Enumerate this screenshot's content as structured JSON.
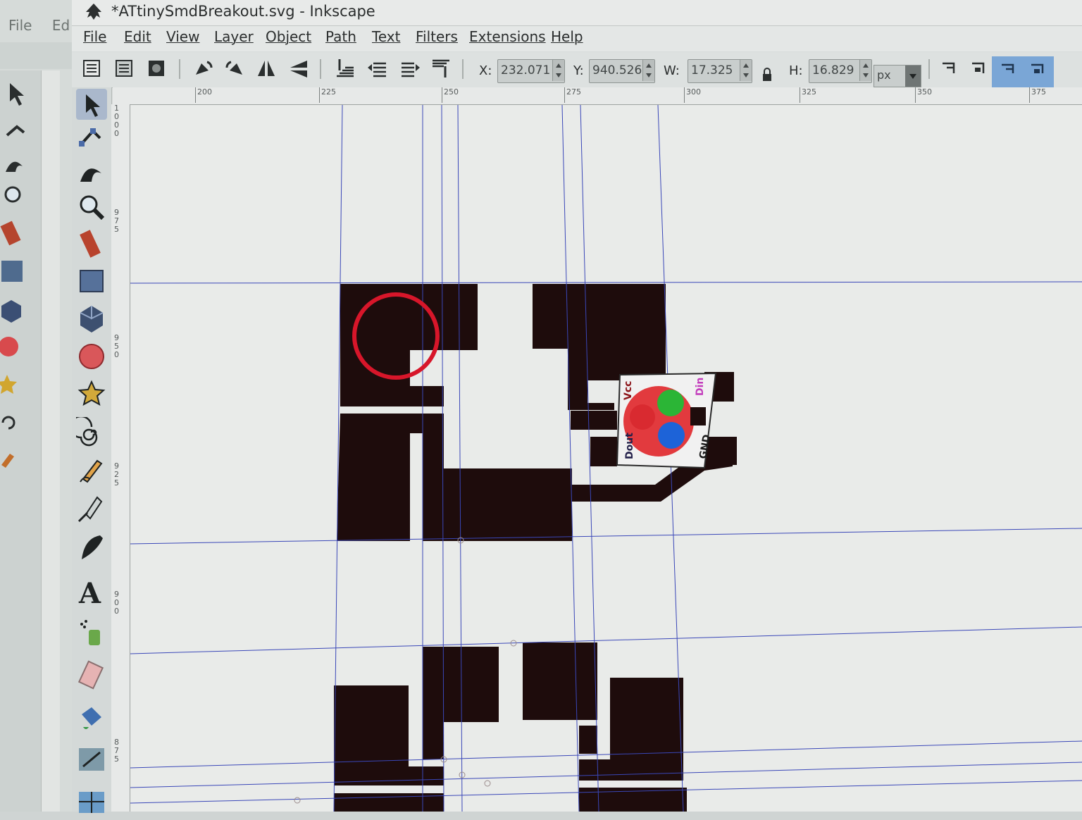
{
  "window": {
    "title": "*ATtinySmdBreakout.svg - Inkscape"
  },
  "background_window": {
    "menu": [
      "File",
      "Ed"
    ]
  },
  "menubar": {
    "items": [
      "File",
      "Edit",
      "View",
      "Layer",
      "Object",
      "Path",
      "Text",
      "Filters",
      "Extensions",
      "Help"
    ]
  },
  "toolbar": {
    "x_label": "X:",
    "x_value": "232.071",
    "y_label": "Y:",
    "y_value": "940.526",
    "w_label": "W:",
    "w_value": "17.325",
    "h_label": "H:",
    "h_value": "16.829",
    "unit": "px"
  },
  "rulers": {
    "horizontal": [
      "200",
      "225",
      "250",
      "275",
      "300",
      "325",
      "350",
      "375"
    ],
    "vertical": [
      "1000",
      "975",
      "950",
      "925",
      "900",
      "875"
    ]
  },
  "canvas": {
    "led_labels": {
      "vcc": "Vcc",
      "din": "Din",
      "dout": "Dout",
      "gnd": "GND"
    },
    "colors": {
      "copper": "#1e0c0c",
      "guide": "#3a47b8",
      "selection_circle": "#d7162a",
      "led_red": "#e23a3e",
      "led_green": "#2bb536",
      "led_blue": "#1d63d8"
    }
  },
  "tools": [
    "selector-tool",
    "node-tool",
    "tweak-tool",
    "zoom-tool",
    "measure-tool",
    "rectangle-tool",
    "3d-box-tool",
    "ellipse-tool",
    "star-tool",
    "spiral-tool",
    "pencil-tool",
    "pen-tool",
    "calligraphy-tool",
    "text-tool",
    "spray-tool",
    "eraser-tool",
    "paint-bucket-tool",
    "gradient-tool",
    "mesh-tool"
  ]
}
